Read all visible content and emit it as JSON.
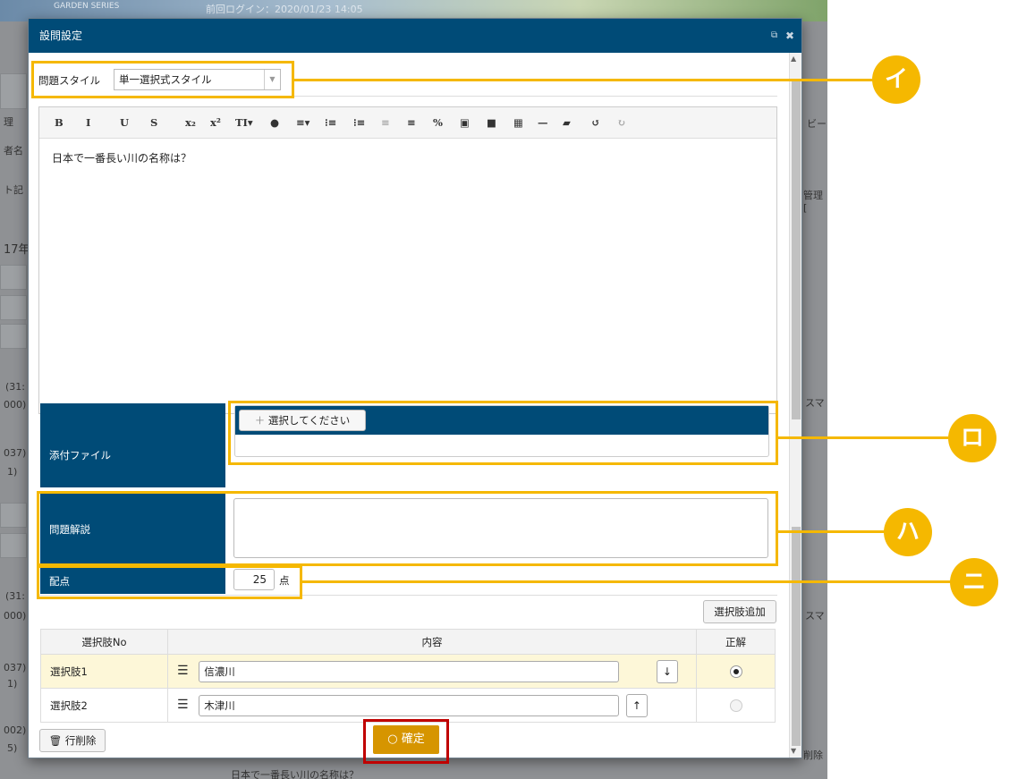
{
  "background": {
    "banner_left": "GARDEN SERIES",
    "banner_center": "前回ログイン：2020/01/23 14:05",
    "left_fragments": [
      "理",
      "者名",
      "ト記",
      "17年",
      "(31:",
      "000)",
      "037)",
      "1)",
      "(31:",
      "000)",
      "037)",
      "1)",
      "002)",
      "5)"
    ],
    "right_fragments": [
      "ビー",
      "管理 [",
      "スマ",
      "スマ",
      "削除"
    ],
    "bottom_text": "日本で一番長い川の名称は？"
  },
  "modal": {
    "title": "設問設定",
    "popout_icon": "external-icon",
    "close_icon": "close-icon",
    "style_label": "問題スタイル",
    "style_value": "単一選択式スタイル",
    "toolbar_icons": [
      "bold-icon",
      "italic-icon",
      "underline-icon",
      "strikethrough-icon",
      "subscript-icon",
      "superscript-icon",
      "font-size-icon",
      "color-icon",
      "align-icon",
      "ordered-list-icon",
      "unordered-list-icon",
      "outdent-icon",
      "indent-icon",
      "link-icon",
      "image-icon",
      "video-icon",
      "table-icon",
      "hr-icon",
      "eraser-icon",
      "undo-icon",
      "redo-icon"
    ],
    "toolbar_glyphs": [
      "B",
      "I",
      "U",
      "S",
      "x₂",
      "x²",
      "TI▾",
      "●",
      "≡▾",
      "⁝≡",
      "⁝≡",
      "≡",
      "≡",
      "%",
      "▣",
      "■",
      "▦",
      "—",
      "▰",
      "↺",
      "↻"
    ],
    "editor_text": "日本で一番長い川の名称は？",
    "attach_label": "添付ファイル",
    "attach_button": "選択してください",
    "explain_label": "問題解説",
    "explain_value": "",
    "score_label": "配点",
    "score_value": "25",
    "score_unit": "点",
    "add_choice_button": "選択肢追加",
    "table_headers": [
      "選択肢No",
      "内容",
      "正解"
    ],
    "choices": [
      {
        "no": "選択肢1",
        "content": "信濃川",
        "move": "↓",
        "correct": true
      },
      {
        "no": "選択肢2",
        "content": "木津川",
        "move": "↑",
        "correct": false
      }
    ],
    "delete_row_button": "行削除",
    "confirm_button": "確定"
  },
  "markers": [
    "イ",
    "ロ",
    "ハ",
    "ニ"
  ],
  "colors": {
    "header": "#004b77",
    "highlight": "#f5b800",
    "confirm": "#d69500",
    "confirm_frame": "#c00000"
  }
}
